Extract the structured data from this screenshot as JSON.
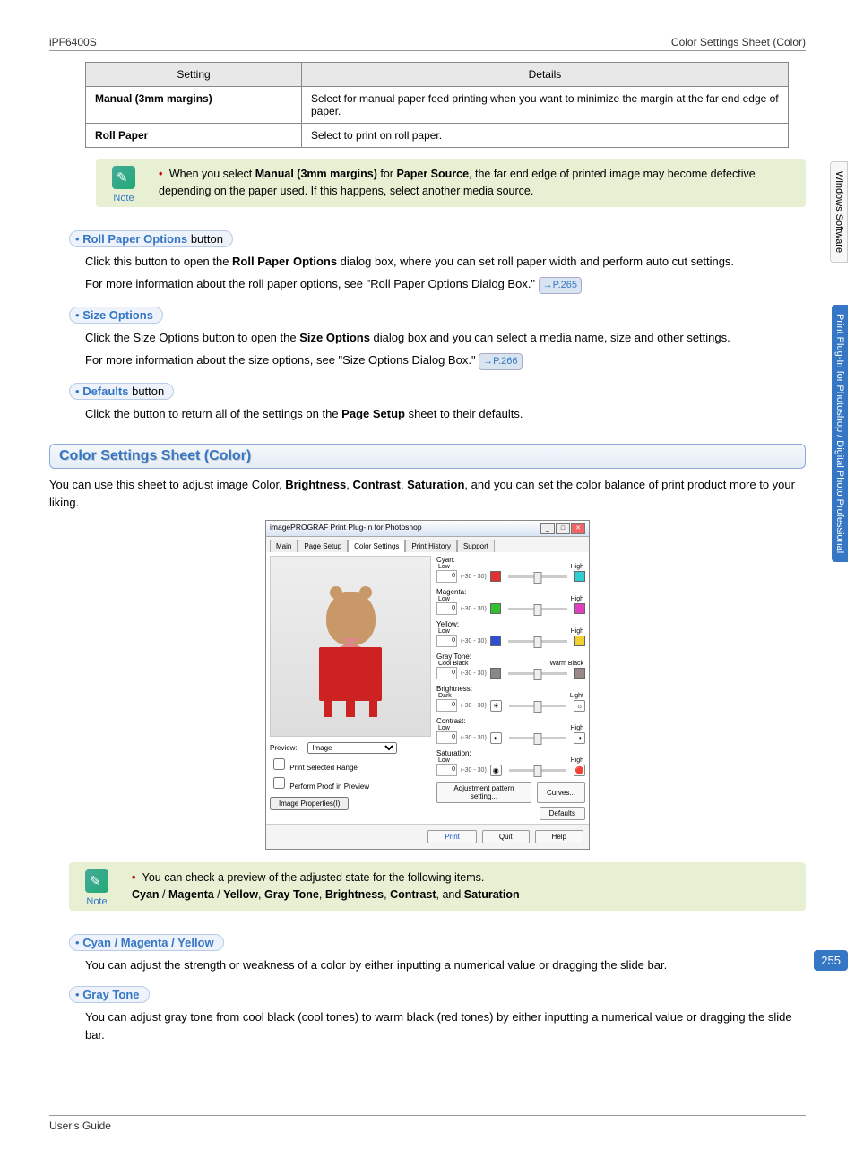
{
  "header": {
    "left": "iPF6400S",
    "right": "Color Settings Sheet (Color)"
  },
  "table": {
    "head_setting": "Setting",
    "head_details": "Details",
    "rows": [
      {
        "name": "Manual (3mm margins)",
        "details": "Select for manual paper feed printing when you want to minimize the margin at the far end edge of paper."
      },
      {
        "name": "Roll Paper",
        "details": "Select to print on roll paper."
      }
    ]
  },
  "note1": {
    "label": "Note",
    "pre": "When you select ",
    "b1": "Manual (3mm margins)",
    "mid1": " for ",
    "b2": "Paper Source",
    "post": ", the far end edge of printed image may become defective depending on the paper used. If this happens, select another media source."
  },
  "rollpaper": {
    "title_bold": "Roll Paper Options",
    "title_plain": " button",
    "l1a": "Click this button to open the ",
    "l1b": "Roll Paper Options",
    "l1c": " dialog box, where you can set roll paper width and perform auto cut settings.",
    "l2": "For more information about the roll paper options, see \"Roll Paper Options Dialog Box.\" ",
    "ref": "→P.265"
  },
  "sizeopt": {
    "title_bold": "Size Options",
    "l1a": "Click the Size Options button to open the ",
    "l1b": "Size Options",
    "l1c": " dialog box and you can select a media name, size and other settings.",
    "l2": "For more information about the size options, see \"Size Options Dialog Box.\" ",
    "ref": "→P.266"
  },
  "defaults": {
    "title_bold": "Defaults",
    "title_plain": " button",
    "l1a": "Click the button to return all of the settings on the ",
    "l1b": "Page Setup",
    "l1c": " sheet to their defaults."
  },
  "section_title": "Color Settings Sheet (Color)",
  "intro": {
    "a": "You can use this sheet to adjust image Color, ",
    "b1": "Brightness",
    "c1": ", ",
    "b2": "Contrast",
    "c2": ", ",
    "b3": "Saturation",
    "d": ", and you can set the color balance of print product more to your liking."
  },
  "dialog": {
    "title": "imagePROGRAF Print Plug-In for Photoshop",
    "tabs": [
      "Main",
      "Page Setup",
      "Color Settings",
      "Print History",
      "Support"
    ],
    "preview_label": "Preview:",
    "preview_value": "Image",
    "chk1": "Print Selected Range",
    "chk2": "Perform Proof in Preview",
    "img_props": "Image Properties(I)",
    "range_text": "(-30 - 30)",
    "sliders": [
      {
        "name": "Cyan:",
        "low": "Low",
        "high": "High",
        "lcolor": "#e03030",
        "rcolor": "#30d0d0"
      },
      {
        "name": "Magenta:",
        "low": "Low",
        "high": "High",
        "lcolor": "#30c030",
        "rcolor": "#e040c0"
      },
      {
        "name": "Yellow:",
        "low": "Low",
        "high": "High",
        "lcolor": "#3050d0",
        "rcolor": "#f0d030"
      },
      {
        "name": "Gray Tone:",
        "low": "Cool Black",
        "high": "Warm Black",
        "lcolor": "#888",
        "rcolor": "#988"
      }
    ],
    "extras": [
      {
        "name": "Brightness:",
        "low": "Dark",
        "high": "Light",
        "licon": "☀",
        "ricon": "☼"
      },
      {
        "name": "Contrast:",
        "low": "Low",
        "high": "High",
        "licon": "◐",
        "ricon": "◑"
      },
      {
        "name": "Saturation:",
        "low": "Low",
        "high": "High",
        "licon": "◉",
        "ricon": "🔴"
      }
    ],
    "btn_adj": "Adjustment pattern setting...",
    "btn_curves": "Curves...",
    "btn_defaults": "Defaults",
    "btn_print": "Print",
    "btn_quit": "Quit",
    "btn_help": "Help"
  },
  "note2": {
    "label": "Note",
    "l1": "You can check a preview of the adjusted state for the following items.",
    "b1": "Cyan",
    "s1": " / ",
    "b2": "Magenta",
    "s2": " / ",
    "b3": "Yellow",
    "c1": ", ",
    "b4": "Gray Tone",
    "c2": ", ",
    "b5": "Brightness",
    "c3": ", ",
    "b6": "Contrast",
    "c4": ", and ",
    "b7": "Saturation"
  },
  "cmy": {
    "title_bold": "Cyan / Magenta / Yellow",
    "body": "You can adjust the strength or weakness of a color by either inputting a numerical value or dragging the slide bar."
  },
  "gray": {
    "title_bold": "Gray Tone",
    "body": "You can adjust gray tone from cool black (cool tones) to warm black (red tones) by either inputting a numerical value or dragging the slide bar."
  },
  "side_tabs": {
    "t1": "Windows Software",
    "t2": "Print Plug-In for Photoshop / Digital Photo Professional"
  },
  "page_number": "255",
  "footer": {
    "left": "User's Guide",
    "right": ""
  }
}
